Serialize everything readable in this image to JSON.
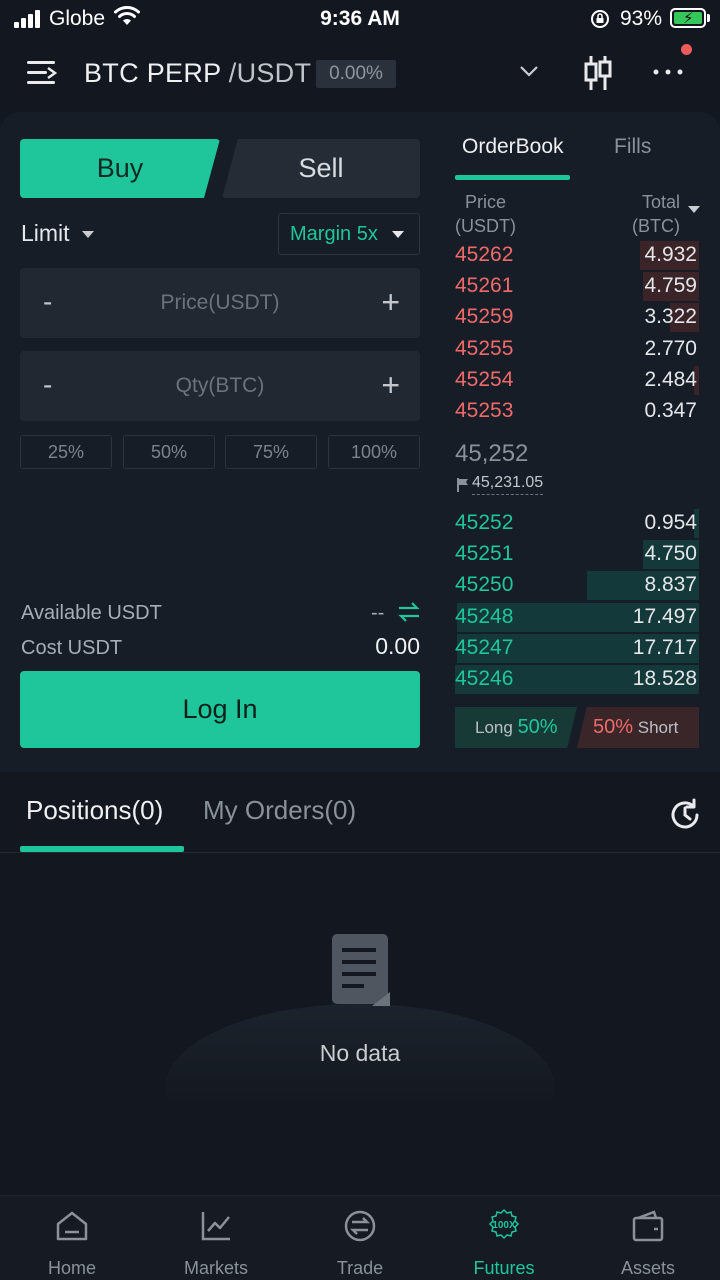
{
  "status_bar": {
    "carrier": "Globe",
    "time": "9:36 AM",
    "battery": "93%"
  },
  "header": {
    "pair_base": "BTC PERP",
    "pair_quote": "/USDT",
    "change": "0.00%"
  },
  "trade_form": {
    "buy_label": "Buy",
    "sell_label": "Sell",
    "order_type": "Limit",
    "margin": "Margin 5x",
    "price_placeholder": "Price(USDT)",
    "qty_placeholder": "Qty(BTC)",
    "minus": "-",
    "plus": "+",
    "percents": [
      "25%",
      "50%",
      "75%",
      "100%"
    ],
    "available_label": "Available USDT",
    "available_value": "--",
    "cost_label": "Cost USDT",
    "cost_value": "0.00",
    "login_label": "Log In"
  },
  "orderbook": {
    "tab_orderbook": "OrderBook",
    "tab_fills": "Fills",
    "price_header_1": "Price",
    "price_header_2": "(USDT)",
    "total_header_1": "Total",
    "total_header_2": "(BTC)",
    "asks": [
      {
        "price": "45262",
        "total": "4.932",
        "depth": 0.24
      },
      {
        "price": "45261",
        "total": "4.759",
        "depth": 0.23
      },
      {
        "price": "45259",
        "total": "3.322",
        "depth": 0.12
      },
      {
        "price": "45255",
        "total": "2.770",
        "depth": 0.0
      },
      {
        "price": "45254",
        "total": "2.484",
        "depth": 0.02
      },
      {
        "price": "45253",
        "total": "0.347",
        "depth": 0.0
      }
    ],
    "mid_price": "45,252",
    "mark_price": "45,231.05",
    "bids": [
      {
        "price": "45252",
        "total": "0.954",
        "depth": 0.02
      },
      {
        "price": "45251",
        "total": "4.750",
        "depth": 0.23
      },
      {
        "price": "45250",
        "total": "8.837",
        "depth": 0.46
      },
      {
        "price": "45248",
        "total": "17.497",
        "depth": 0.99
      },
      {
        "price": "45247",
        "total": "17.717",
        "depth": 0.99
      },
      {
        "price": "45246",
        "total": "18.528",
        "depth": 1.0
      }
    ],
    "long_label": "Long",
    "long_pct": "50%",
    "short_pct": "50%",
    "short_label": "Short"
  },
  "positions": {
    "tab_positions": "Positions(0)",
    "tab_orders": "My Orders(0)",
    "empty_text": "No data"
  },
  "tab_bar": {
    "items": [
      {
        "label": "Home",
        "icon": "home-icon"
      },
      {
        "label": "Markets",
        "icon": "markets-icon"
      },
      {
        "label": "Trade",
        "icon": "trade-icon"
      },
      {
        "label": "Futures",
        "icon": "futures-icon"
      },
      {
        "label": "Assets",
        "icon": "assets-icon"
      }
    ],
    "active": "Futures",
    "futures_badge": "100X"
  },
  "colors": {
    "accent": "#1fc69c",
    "ask": "#f06a6a",
    "background": "#131820"
  }
}
